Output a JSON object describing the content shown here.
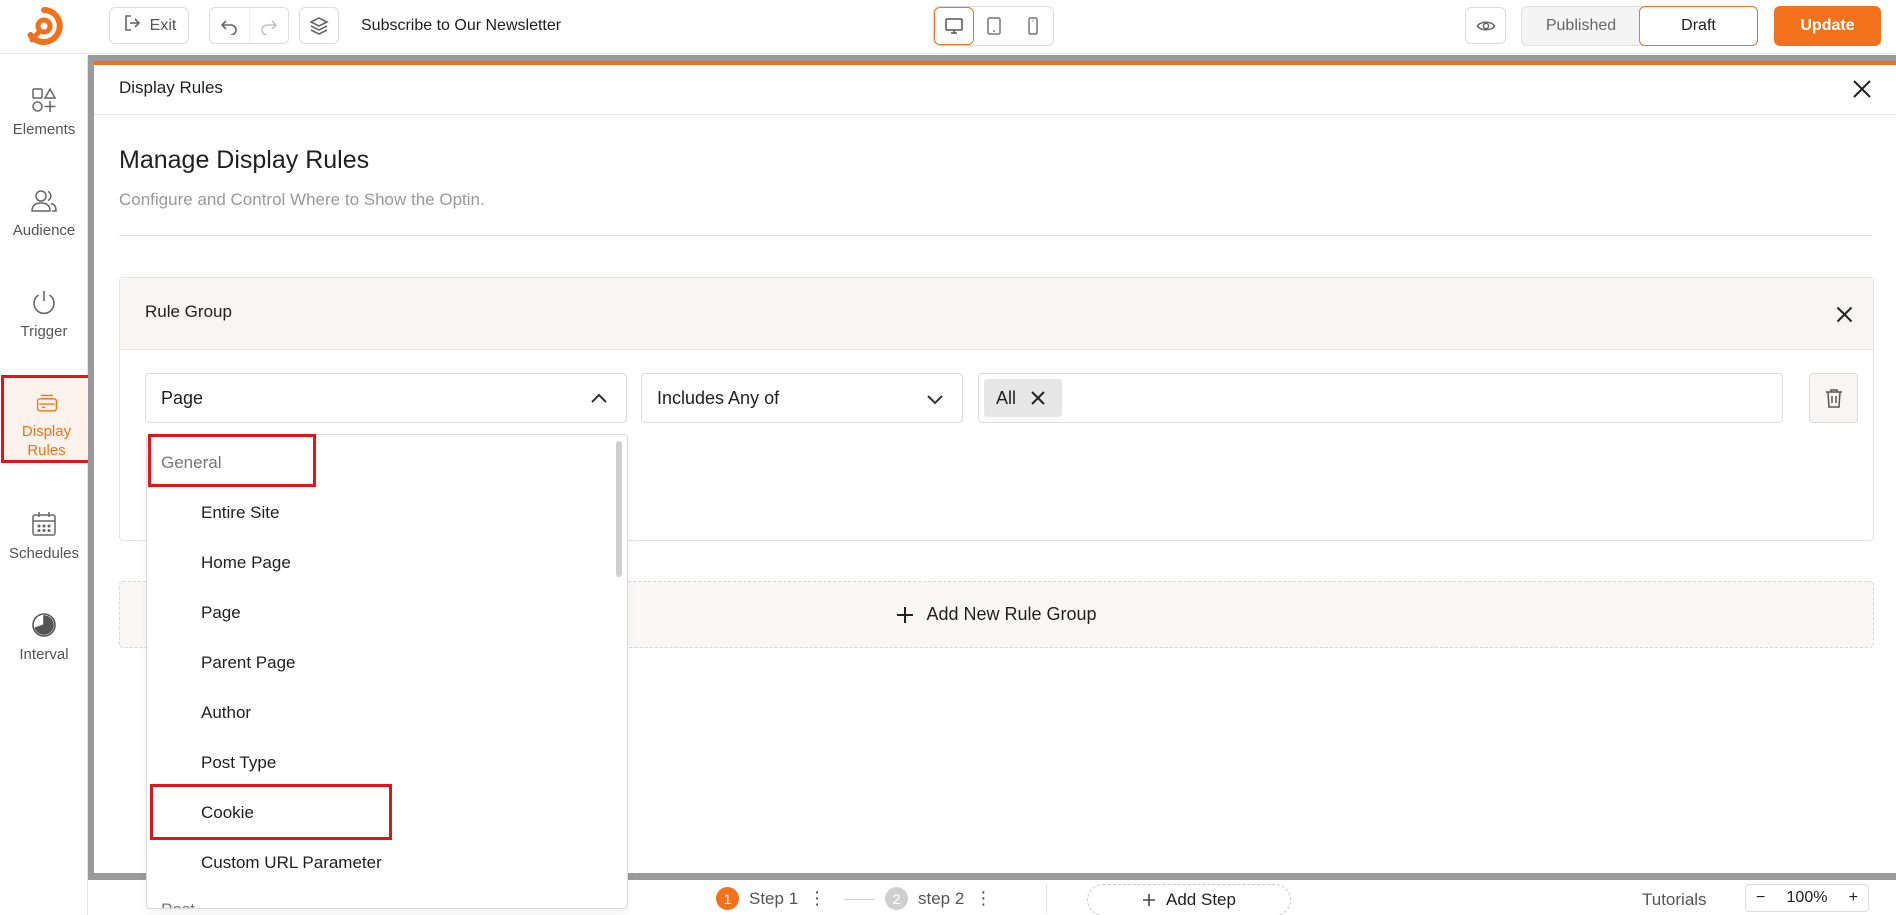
{
  "topbar": {
    "exit_label": "Exit",
    "doc_title": "Subscribe to Our Newsletter",
    "status_published": "Published",
    "status_draft": "Draft",
    "update_label": "Update"
  },
  "sidebar": {
    "items": [
      {
        "label": "Elements",
        "icon": "elements-icon"
      },
      {
        "label": "Audience",
        "icon": "audience-icon"
      },
      {
        "label": "Trigger",
        "icon": "power-icon"
      },
      {
        "label": "Display\nRules",
        "label_line1": "Display",
        "label_line2": "Rules",
        "icon": "display-rules-icon",
        "active": true
      },
      {
        "label": "Schedules",
        "icon": "calendar-icon"
      },
      {
        "label": "Interval",
        "icon": "interval-icon"
      }
    ]
  },
  "panel": {
    "header_title": "Display Rules",
    "heading": "Manage Display Rules",
    "subheading": "Configure and Control Where to Show the Optin.",
    "rule_group_title": "Rule Group",
    "condition_select": "Page",
    "operator_select": "Includes Any of",
    "value_tag": "All",
    "add_group_label": "Add New Rule Group"
  },
  "dropdown": {
    "group_general": "General",
    "items": [
      "Entire Site",
      "Home Page",
      "Page",
      "Parent Page",
      "Author",
      "Post Type",
      "Cookie",
      "Custom URL Parameter"
    ],
    "group_next": "Post"
  },
  "bottombar": {
    "step1_num": "1",
    "step1_label": "Step 1",
    "step2_num": "2",
    "step2_label": "step 2",
    "add_step_label": "Add Step",
    "tutorials_label": "Tutorials",
    "zoom_value": "100%"
  },
  "colors": {
    "accent": "#f2711c",
    "highlight": "#e0161b"
  }
}
